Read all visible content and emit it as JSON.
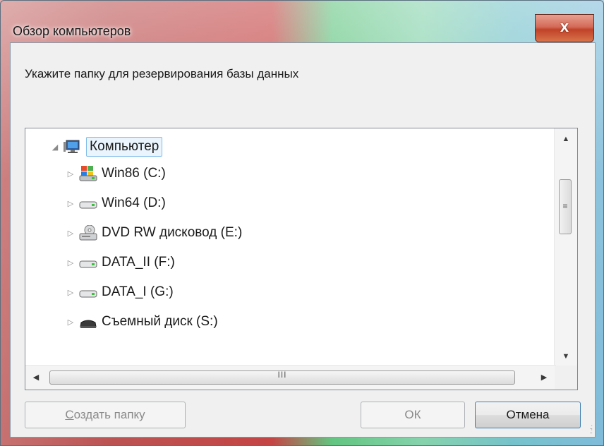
{
  "window": {
    "title": "Обзор компьютеров",
    "close_label": "x"
  },
  "prompt": "Укажите папку для резервирования базы данных",
  "tree": {
    "root": {
      "label": "Компьютер",
      "icon": "computer-icon",
      "expanded": true,
      "selected": true
    },
    "items": [
      {
        "label": "Win86 (C:)",
        "icon": "windows-drive-icon"
      },
      {
        "label": "Win64 (D:)",
        "icon": "hard-drive-icon"
      },
      {
        "label": "DVD RW дисковод (E:)",
        "icon": "dvd-drive-icon"
      },
      {
        "label": "DATA_II (F:)",
        "icon": "hard-drive-icon"
      },
      {
        "label": "DATA_I (G:)",
        "icon": "hard-drive-icon"
      },
      {
        "label": "Съемный диск (S:)",
        "icon": "removable-drive-icon"
      }
    ]
  },
  "buttons": {
    "new_folder_prefix": "С",
    "new_folder_rest": "оздать папку",
    "ok": "ОК",
    "cancel": "Отмена"
  },
  "scrollbar": {
    "hthumb_grip": "III",
    "vthumb_grip": "≡"
  },
  "colors": {
    "selection_bg": "#eaf4fd",
    "selection_border": "#7fbce8",
    "default_button_border": "#3c7fb1"
  }
}
